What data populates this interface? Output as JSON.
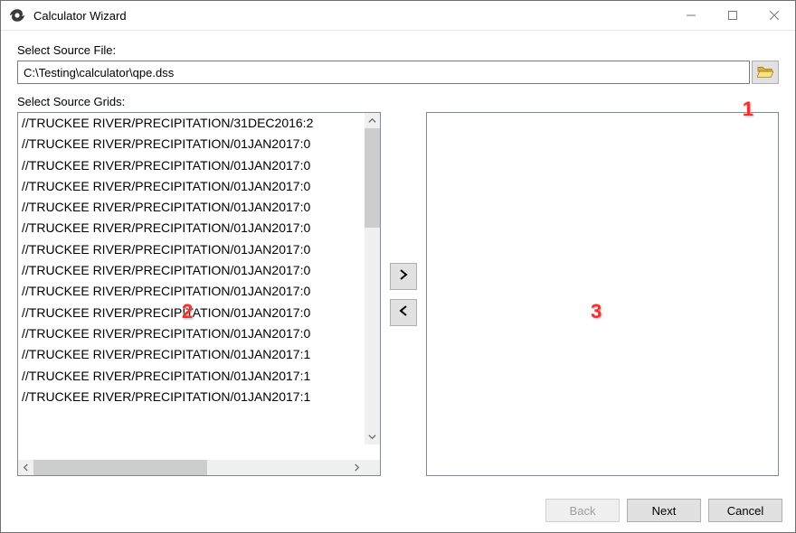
{
  "window": {
    "title": "Calculator Wizard"
  },
  "labels": {
    "source_file": "Select Source File:",
    "source_grids": "Select Source Grids:"
  },
  "source_file": {
    "value": "C:\\Testing\\calculator\\qpe.dss"
  },
  "callouts": {
    "one": "1",
    "two": "2",
    "three": "3"
  },
  "grids": {
    "items": [
      "//TRUCKEE RIVER/PRECIPITATION/31DEC2016:2",
      "//TRUCKEE RIVER/PRECIPITATION/01JAN2017:0",
      "//TRUCKEE RIVER/PRECIPITATION/01JAN2017:0",
      "//TRUCKEE RIVER/PRECIPITATION/01JAN2017:0",
      "//TRUCKEE RIVER/PRECIPITATION/01JAN2017:0",
      "//TRUCKEE RIVER/PRECIPITATION/01JAN2017:0",
      "//TRUCKEE RIVER/PRECIPITATION/01JAN2017:0",
      "//TRUCKEE RIVER/PRECIPITATION/01JAN2017:0",
      "//TRUCKEE RIVER/PRECIPITATION/01JAN2017:0",
      "//TRUCKEE RIVER/PRECIPITATION/01JAN2017:0",
      "//TRUCKEE RIVER/PRECIPITATION/01JAN2017:0",
      "//TRUCKEE RIVER/PRECIPITATION/01JAN2017:1",
      "//TRUCKEE RIVER/PRECIPITATION/01JAN2017:1",
      "//TRUCKEE RIVER/PRECIPITATION/01JAN2017:1"
    ]
  },
  "buttons": {
    "back": "Back",
    "next": "Next",
    "cancel": "Cancel"
  },
  "icons": {
    "browse": "open-folder-icon",
    "move_right": "chevron-right-icon",
    "move_left": "chevron-left-icon"
  }
}
